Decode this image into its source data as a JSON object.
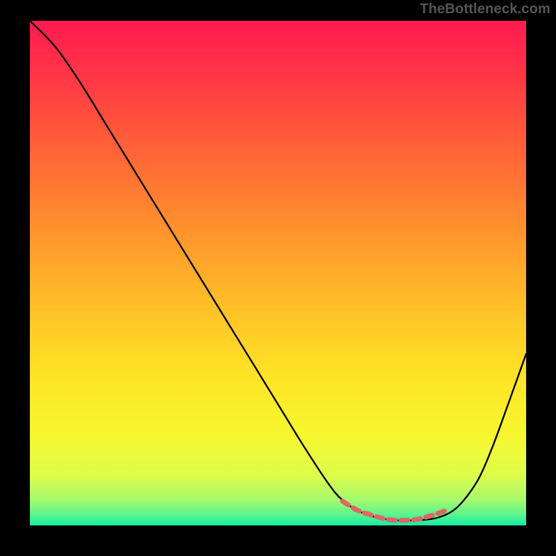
{
  "attribution": "TheBottleneck.com",
  "colors": {
    "gradient_stops": [
      {
        "offset": 0.0,
        "color": "#ff1b51"
      },
      {
        "offset": 0.1,
        "color": "#ff3346"
      },
      {
        "offset": 0.25,
        "color": "#ff6138"
      },
      {
        "offset": 0.4,
        "color": "#ff8e2e"
      },
      {
        "offset": 0.55,
        "color": "#ffbb28"
      },
      {
        "offset": 0.7,
        "color": "#ffe326"
      },
      {
        "offset": 0.82,
        "color": "#f7f72f"
      },
      {
        "offset": 0.9,
        "color": "#e0fc4a"
      },
      {
        "offset": 0.95,
        "color": "#a5fa6f"
      },
      {
        "offset": 0.98,
        "color": "#57f48f"
      },
      {
        "offset": 1.0,
        "color": "#11eda7"
      }
    ],
    "curve": "#000000",
    "flat_segment": "#e06666",
    "background": "#000000"
  },
  "chart_data": {
    "type": "line",
    "title": "",
    "xlabel": "",
    "ylabel": "",
    "xlim": [
      0,
      1
    ],
    "ylim": [
      0,
      1
    ],
    "series": [
      {
        "name": "bottleneck-curve",
        "x": [
          0.0,
          0.05,
          0.1,
          0.15,
          0.2,
          0.25,
          0.3,
          0.35,
          0.4,
          0.45,
          0.5,
          0.55,
          0.6,
          0.63,
          0.67,
          0.72,
          0.77,
          0.82,
          0.86,
          0.9,
          0.93,
          0.96,
          1.0
        ],
        "y": [
          1.0,
          0.95,
          0.88,
          0.8,
          0.72,
          0.64,
          0.56,
          0.48,
          0.4,
          0.32,
          0.24,
          0.16,
          0.085,
          0.05,
          0.025,
          0.012,
          0.01,
          0.015,
          0.035,
          0.085,
          0.15,
          0.23,
          0.34
        ]
      },
      {
        "name": "flat-minimum-highlight",
        "x": [
          0.63,
          0.66,
          0.69,
          0.72,
          0.75,
          0.78,
          0.81,
          0.84
        ],
        "y": [
          0.048,
          0.03,
          0.02,
          0.012,
          0.01,
          0.012,
          0.02,
          0.03
        ]
      }
    ]
  }
}
